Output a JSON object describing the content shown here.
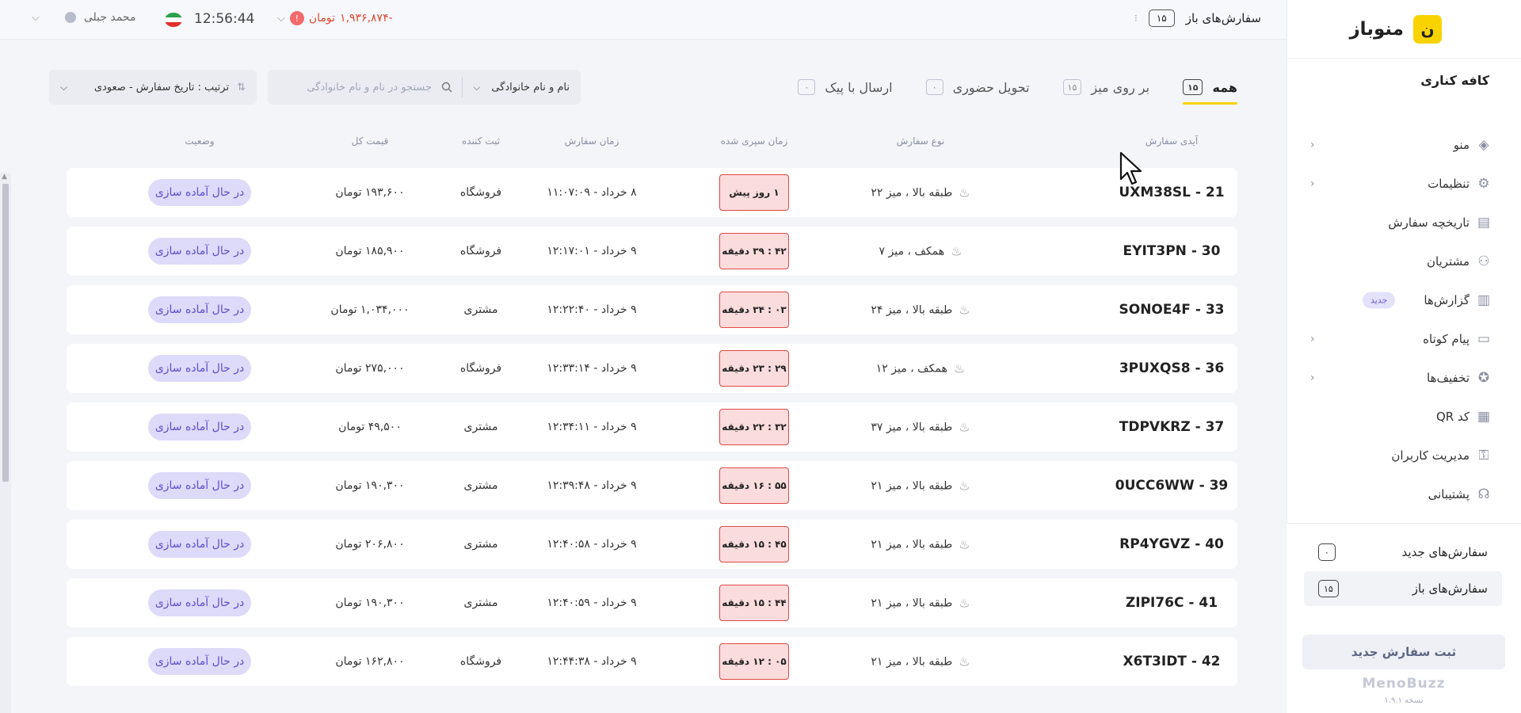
{
  "sidebar": {
    "logo_text": "منوباز",
    "logo_glyph": "ن",
    "cafe_name": "کافه کناری",
    "items": [
      {
        "label": "منو",
        "icon": "layers-icon",
        "chevron": true
      },
      {
        "label": "تنظیمات",
        "icon": "gear-icon",
        "chevron": true
      },
      {
        "label": "تاریخچه سفارش",
        "icon": "document-icon",
        "chevron": false
      },
      {
        "label": "مشتریان",
        "icon": "users-icon",
        "chevron": false
      },
      {
        "label": "گزارش‌ها",
        "icon": "chart-icon",
        "chevron": false,
        "badge": "جدید"
      },
      {
        "label": "پیام کوتاه",
        "icon": "message-icon",
        "chevron": true
      },
      {
        "label": "تخفیف‌ها",
        "icon": "discount-icon",
        "chevron": true
      },
      {
        "label": "کد QR",
        "icon": "qr-icon",
        "chevron": false
      },
      {
        "label": "مدیریت کاربران",
        "icon": "key-icon",
        "chevron": false
      },
      {
        "label": "پشتیبانی",
        "icon": "headset-icon",
        "chevron": false
      }
    ],
    "new_orders_label": "سفارش‌های جدید",
    "new_orders_count": "۰",
    "open_orders_label": "سفارش‌های باز",
    "open_orders_count": "۱۵",
    "new_order_button": "ثبت سفارش جدید",
    "brand": "MenoBuzz",
    "version": "نسخه ۱.۹.۱"
  },
  "topbar": {
    "open_orders_label": "سفارش‌های باز",
    "open_orders_count": "۱۵",
    "balance": "-۱,۹۳۶,۸۷۴",
    "balance_unit": "تومان",
    "time": "12:56:44",
    "user_name": "محمد جبلی"
  },
  "filters": {
    "tabs": [
      {
        "label": "همه",
        "count": "۱۵",
        "active": true
      },
      {
        "label": "بر روی میز",
        "count": "۱۵",
        "active": false
      },
      {
        "label": "تحویل حضوری",
        "count": "۰",
        "active": false
      },
      {
        "label": "ارسال با پیک",
        "count": "۰",
        "active": false
      }
    ],
    "search_field": "نام و نام خانوادگی",
    "search_placeholder": "جستجو در  نام و نام خانوادگی",
    "sort_label": "ترتیب : تاریخ سفارش - صعودی"
  },
  "table": {
    "headers": {
      "id": "آیدی سفارش",
      "type": "نوع سفارش",
      "elapsed": "زمان سپری شده",
      "time": "زمان سفارش",
      "registrar": "ثبت کننده",
      "price": "قیمت کل",
      "status": "وضعیت"
    },
    "rows": [
      {
        "id": "21 - UXM38SL",
        "type": "طبقه بالا ، میز ۲۲",
        "elapsed": "۱ روز پیش",
        "time": "۸ خرداد - ۱۱:۰۷:۰۹",
        "registrar": "فروشگاه",
        "price": "۱۹۳,۶۰۰ تومان",
        "status": "در حال آماده سازی"
      },
      {
        "id": "30 - EYIT3PN",
        "type": "همکف ، میز ۷",
        "elapsed": "۴۲ : ۳۹ دقیقه",
        "time": "۹ خرداد - ۱۲:۱۷:۰۱",
        "registrar": "فروشگاه",
        "price": "۱۸۵,۹۰۰ تومان",
        "status": "در حال آماده سازی"
      },
      {
        "id": "33 - SONOE4F",
        "type": "طبقه بالا ، میز ۲۴",
        "elapsed": "۰۳ : ۳۴ دقیقه",
        "time": "۹ خرداد - ۱۲:۲۲:۴۰",
        "registrar": "مشتری",
        "price": "۱,۰۳۴,۰۰۰ تومان",
        "status": "در حال آماده سازی"
      },
      {
        "id": "36 - 3PUXQS8",
        "type": "همکف ، میز ۱۲",
        "elapsed": "۲۹ : ۲۳ دقیقه",
        "time": "۹ خرداد - ۱۲:۳۳:۱۴",
        "registrar": "فروشگاه",
        "price": "۲۷۵,۰۰۰ تومان",
        "status": "در حال آماده سازی"
      },
      {
        "id": "37 - TDPVKRZ",
        "type": "طبقه بالا ، میز ۳۷",
        "elapsed": "۳۲ : ۲۲ دقیقه",
        "time": "۹ خرداد - ۱۲:۳۴:۱۱",
        "registrar": "مشتری",
        "price": "۴۹,۵۰۰ تومان",
        "status": "در حال آماده سازی"
      },
      {
        "id": "39 - 0UCC6WW",
        "type": "طبقه بالا ، میز ۲۱",
        "elapsed": "۵۵ : ۱۶ دقیقه",
        "time": "۹ خرداد - ۱۲:۳۹:۴۸",
        "registrar": "مشتری",
        "price": "۱۹۰,۳۰۰ تومان",
        "status": "در حال آماده سازی"
      },
      {
        "id": "40 - RP4YGVZ",
        "type": "طبقه بالا ، میز ۲۱",
        "elapsed": "۴۵ : ۱۵ دقیقه",
        "time": "۹ خرداد - ۱۲:۴۰:۵۸",
        "registrar": "مشتری",
        "price": "۲۰۶,۸۰۰ تومان",
        "status": "در حال آماده سازی"
      },
      {
        "id": "41 - ZIPI76C",
        "type": "طبقه بالا ، میز ۲۱",
        "elapsed": "۴۴ : ۱۵ دقیقه",
        "time": "۹ خرداد - ۱۲:۴۰:۵۹",
        "registrar": "مشتری",
        "price": "۱۹۰,۳۰۰ تومان",
        "status": "در حال آماده سازی"
      },
      {
        "id": "42 - X6T3IDT",
        "type": "طبقه بالا ، میز ۲۱",
        "elapsed": "۰۵ : ۱۲ دقیقه",
        "time": "۹ خرداد - ۱۲:۴۴:۳۸",
        "registrar": "فروشگاه",
        "price": "۱۶۲,۸۰۰ تومان",
        "status": "در حال آماده سازی"
      }
    ]
  },
  "colors": {
    "accent": "#f9d300",
    "status_bg": "#dedafa",
    "status_text": "#5b4fcf",
    "elapsed_bg": "#fbdcdc",
    "elapsed_border": "#e14848",
    "balance": "#e0452e"
  }
}
